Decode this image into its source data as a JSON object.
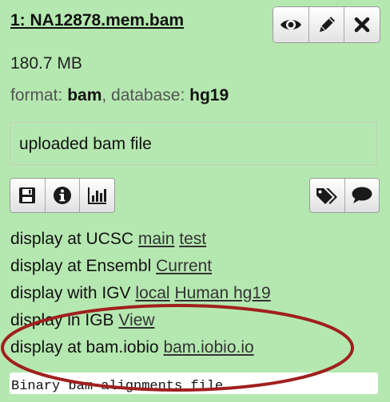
{
  "dataset": {
    "title": "1: NA12878.mem.bam",
    "size": "180.7 MB",
    "format_label": "format:",
    "format_value": "bam",
    "database_label": ", database:",
    "database_value": "hg19",
    "info": "uploaded bam file",
    "peek": "Binary bam alignments file"
  },
  "title_buttons": [
    {
      "name": "view-icon",
      "icon": "eye"
    },
    {
      "name": "edit-icon",
      "icon": "pencil"
    },
    {
      "name": "delete-icon",
      "icon": "x"
    }
  ],
  "tools_left": [
    {
      "name": "save-icon",
      "icon": "floppy-disk"
    },
    {
      "name": "info-icon",
      "icon": "info-circle"
    },
    {
      "name": "visualize-icon",
      "icon": "bar-chart"
    }
  ],
  "tools_right": [
    {
      "name": "tags-icon",
      "icon": "tags"
    },
    {
      "name": "comment-icon",
      "icon": "speech-bubble"
    }
  ],
  "display_links": [
    {
      "prefix": "display at UCSC",
      "links": [
        "main",
        "test"
      ]
    },
    {
      "prefix": "display at Ensembl",
      "links": [
        "Current"
      ]
    },
    {
      "prefix": "display with IGV",
      "links": [
        "local",
        "Human hg19"
      ]
    },
    {
      "prefix": "display in IGB",
      "links": [
        "View"
      ]
    },
    {
      "prefix": "display at bam.iobio",
      "links": [
        "bam.iobio.io"
      ]
    }
  ],
  "annotation": {
    "color": "#a0201e",
    "shape": "ellipse"
  }
}
